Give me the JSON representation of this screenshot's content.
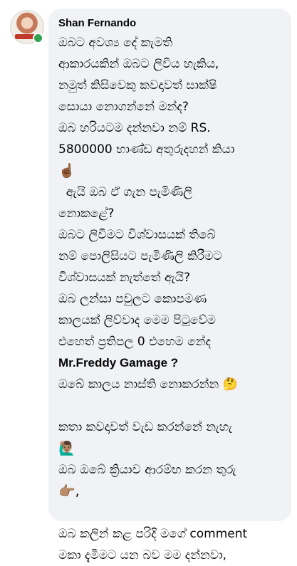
{
  "comment": {
    "author": "Shan Fernando",
    "lines": [
      "ඔබට අවශ්‍ය දේ කැමති",
      "ආකාරයකින් ඔබට ලිවිය හැකිය,",
      "නමුත් කිසිවෙකු කවදාවත් සාක්ෂි",
      "සොයා නොගන්නේ මන්ද?",
      "ඔබ හරියටම දන්නවා නම් RS.",
      "5800000 භාණ්ඩ අතුරුදහන් කියා",
      "☝🏾",
      "  ඇයි ඔබ ඒ ගැන පැමිණිලි",
      "නොකළේ?",
      "ඔබට ලිවීමට විශ්වාසයක් තිබේ",
      "නම් පොලිසියට පැමිණිලි කිරීමට",
      "විශ්වාසයක් නැත්තේ ඇයි?",
      "ඔබ ලන්සා පවුලට කොපමණ",
      "කාලයක් ලිව්වාද මෙම පිටුවේම",
      "එහෙත් ප්‍රතිපල 0 එහෙම නේද",
      "Mr.Freddy Gamage ?",
      "ඔබේ කාලය නාස්ති නොකරන්න 🤔",
      "",
      "කතා කවදාවත් වැඩ කරන්නේ නැහැ",
      "🙋🏽‍♂️",
      "ඔබ ඔබේ ක්‍රියාව ආරම්භ කරන තුරු",
      "👉🏽,",
      "",
      "ඔබ කලින් කළ පරිදි මගේ comment",
      "මකා දැමීමට යන බව මම දන්නවා,"
    ]
  }
}
